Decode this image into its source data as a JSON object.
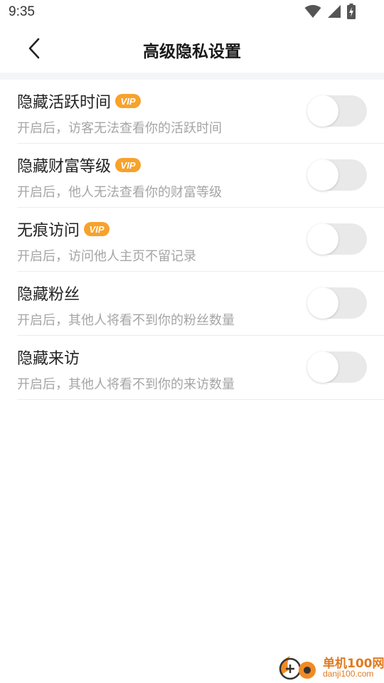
{
  "status_bar": {
    "time": "9:35",
    "icons": [
      "wifi-icon",
      "cell-signal-icon",
      "battery-charging-icon"
    ]
  },
  "header": {
    "back_icon": "back-arrow-icon",
    "title": "高级隐私设置"
  },
  "colors": {
    "vip_badge": "#f7a22b",
    "toggle_off": "#e9e9e9",
    "separator": "#f4f5f8",
    "watermark": "#e07a1f"
  },
  "settings": [
    {
      "title": "隐藏活跃时间",
      "vip": true,
      "vip_label": "VIP",
      "description": "开启后，访客无法查看你的活跃时间",
      "enabled": false
    },
    {
      "title": "隐藏财富等级",
      "vip": true,
      "vip_label": "VIP",
      "description": "开启后，他人无法查看你的财富等级",
      "enabled": false
    },
    {
      "title": "无痕访问",
      "vip": true,
      "vip_label": "VIP",
      "description": "开启后，访问他人主页不留记录",
      "enabled": false
    },
    {
      "title": "隐藏粉丝",
      "vip": false,
      "description": "开启后，其他人将看不到你的粉丝数量",
      "enabled": false
    },
    {
      "title": "隐藏来访",
      "vip": false,
      "description": "开启后，其他人将看不到你的来访数量",
      "enabled": false
    }
  ],
  "watermark": {
    "name": "单机100网",
    "domain": "danji100.com"
  }
}
